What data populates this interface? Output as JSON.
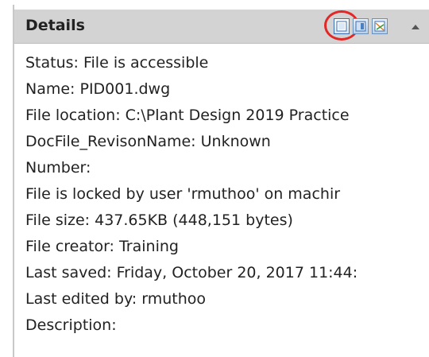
{
  "panel": {
    "title": "Details",
    "view_buttons": [
      {
        "name": "list-view",
        "highlighted": true
      },
      {
        "name": "preview-view",
        "highlighted": false
      },
      {
        "name": "details-view",
        "highlighted": false
      }
    ],
    "highlight_color": "#e32626",
    "header_color": "#d3d3d3"
  },
  "details": {
    "lines": [
      "Status: File is accessible",
      "Name: PID001.dwg",
      "File location: C:\\Plant Design 2019 Practice",
      "DocFile_RevisonName: Unknown",
      "Number:",
      "File is locked by user 'rmuthoo' on machir",
      "File size: 437.65KB (448,151 bytes)",
      "File creator: Training",
      "Last saved: Friday, October 20, 2017 11:44:",
      "Last edited by: rmuthoo",
      "Description:"
    ]
  }
}
